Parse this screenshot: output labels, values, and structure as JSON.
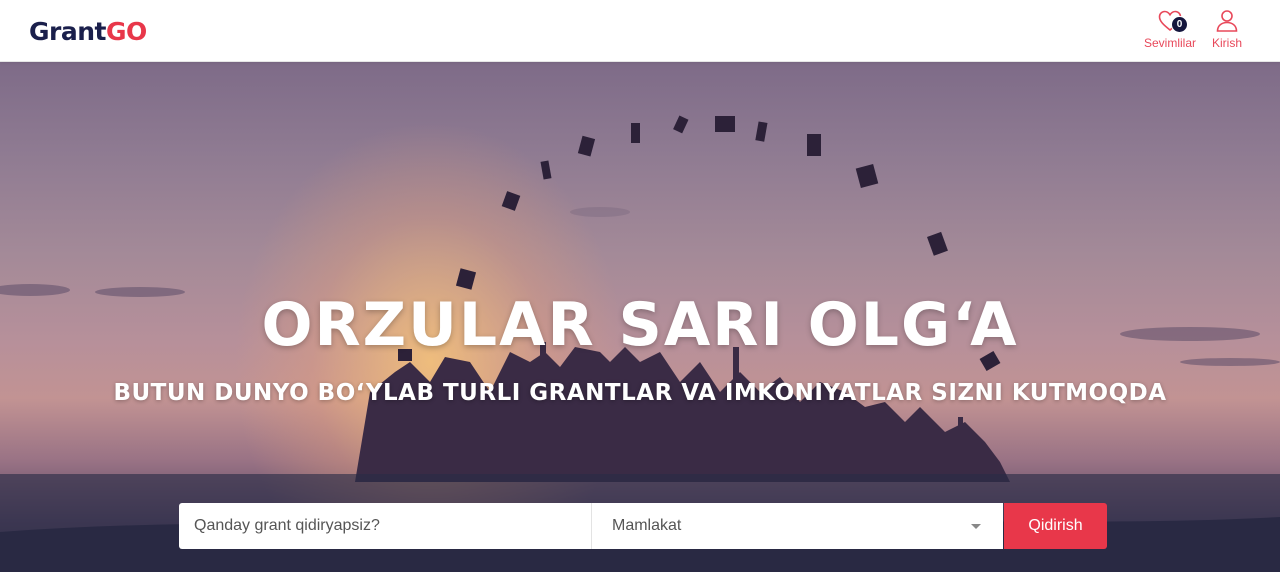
{
  "brand": {
    "logo_part1": "Grant",
    "logo_part2": "GO"
  },
  "header": {
    "favorites": {
      "label": "Sevimlilar",
      "count": "0"
    },
    "login": {
      "label": "Kirish"
    }
  },
  "hero": {
    "title": "ORZULAR SARI OLG‘A",
    "subtitle": "BUTUN DUNYO BO‘YLAB TURLI GRANTLAR VA IMKONIYATLAR SIZNI KUTMOQDA"
  },
  "search": {
    "query_placeholder": "Qanday grant qidiryapsiz?",
    "query_value": "",
    "country_selected": "Mamlakat",
    "submit_label": "Qidirish"
  },
  "colors": {
    "accent": "#e8374a",
    "brand_dark": "#1a1f4b",
    "badge": "#15163d"
  },
  "icons": [
    "heart-icon",
    "user-icon",
    "caret-down-icon"
  ]
}
